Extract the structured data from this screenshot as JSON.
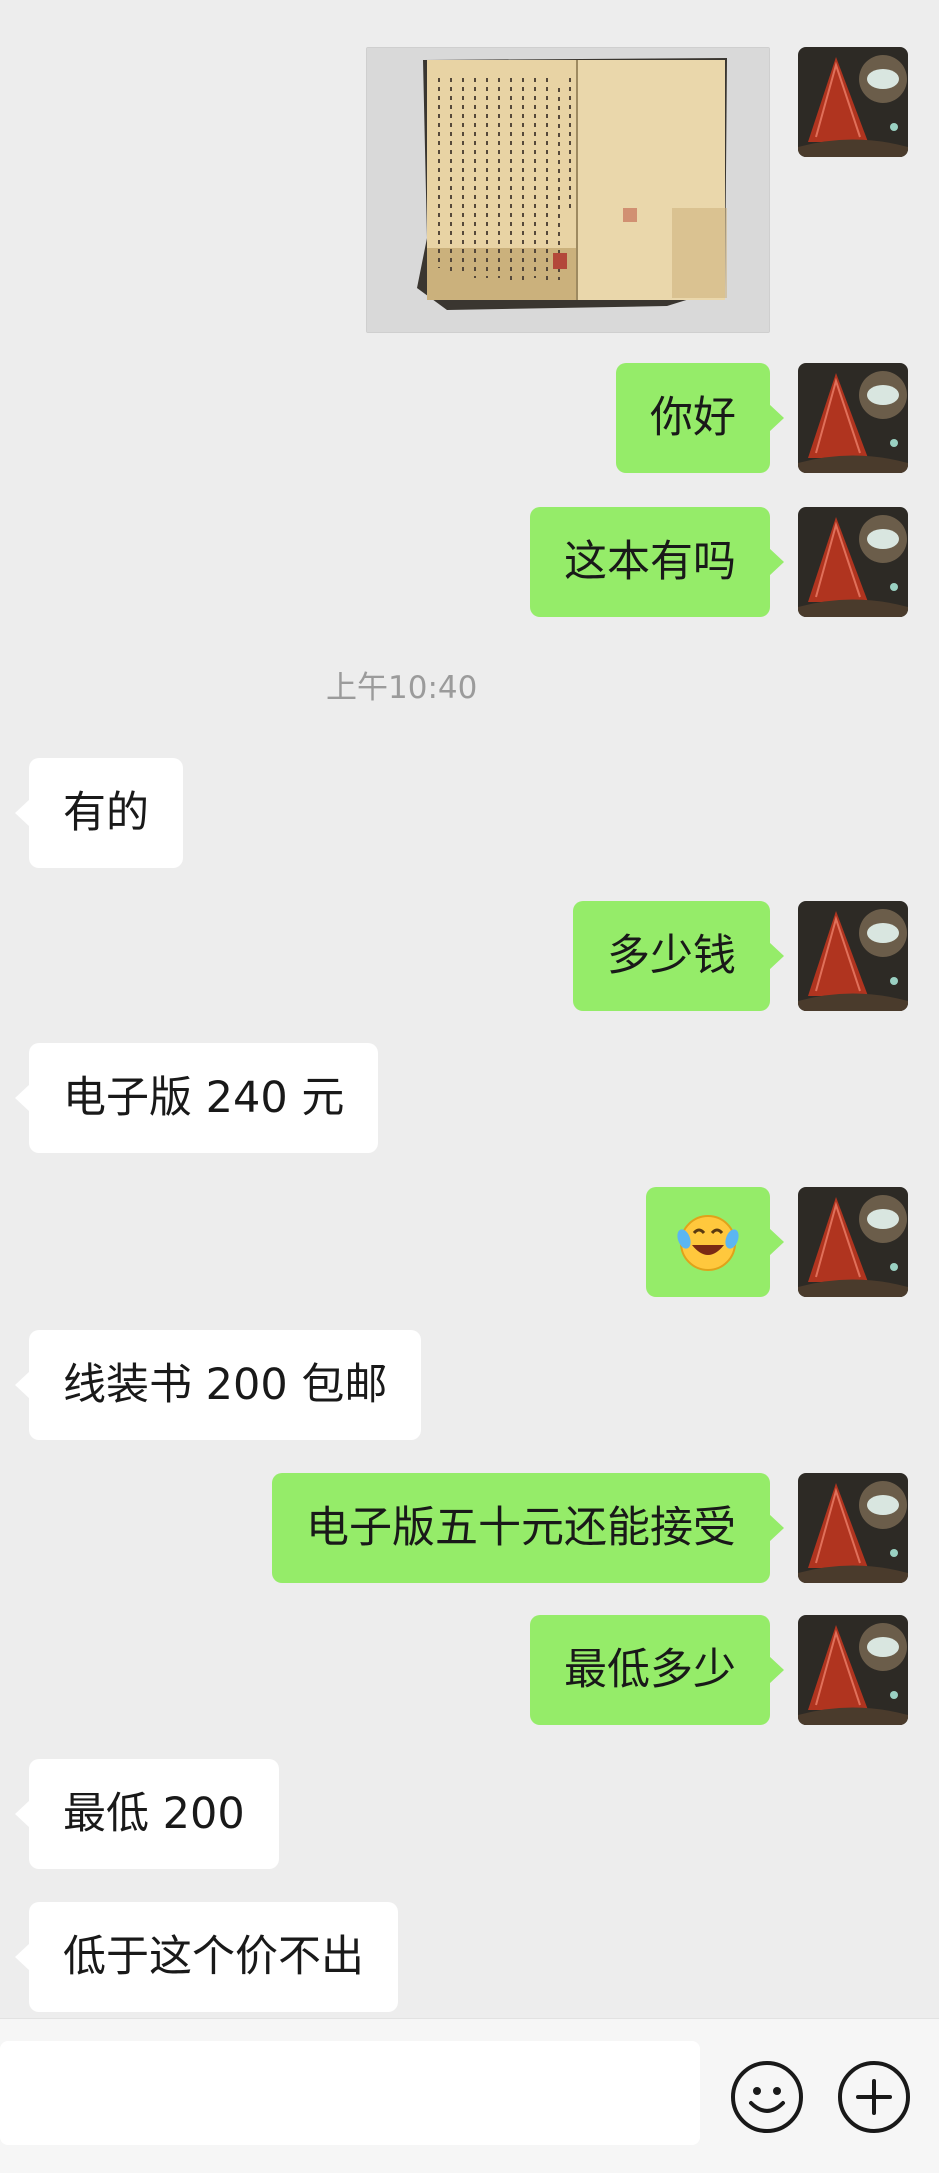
{
  "app": "WeChat chat",
  "colors": {
    "background": "#ededed",
    "outgoing_bubble": "#95ec69",
    "incoming_bubble": "#ffffff",
    "timestamp_text": "#9b9b9b"
  },
  "messages": [
    {
      "side": "out",
      "type": "image",
      "content": "photo of an old thread-bound handwritten Chinese book"
    },
    {
      "side": "out",
      "type": "text",
      "text": "你好"
    },
    {
      "side": "out",
      "type": "text",
      "text": "这本有吗"
    },
    {
      "type": "timestamp",
      "text": "上午10:40"
    },
    {
      "side": "in",
      "type": "text",
      "text": "有的"
    },
    {
      "side": "out",
      "type": "text",
      "text": "多少钱"
    },
    {
      "side": "in",
      "type": "text",
      "text": "电子版 240 元"
    },
    {
      "side": "out",
      "type": "emoji",
      "emoji": "laughing-with-tears-emoji"
    },
    {
      "side": "in",
      "type": "text",
      "text": "线装书 200 包邮"
    },
    {
      "side": "out",
      "type": "text",
      "text": "电子版五十元还能接受"
    },
    {
      "side": "out",
      "type": "text",
      "text": "最低多少"
    },
    {
      "side": "in",
      "type": "text",
      "text": "最低 200"
    },
    {
      "side": "in",
      "type": "text",
      "text": "低于这个价不出"
    }
  ],
  "input_bar": {
    "input_value": "",
    "emoji_icon": "emoji-face-icon",
    "plus_icon": "plus-circle-icon"
  }
}
